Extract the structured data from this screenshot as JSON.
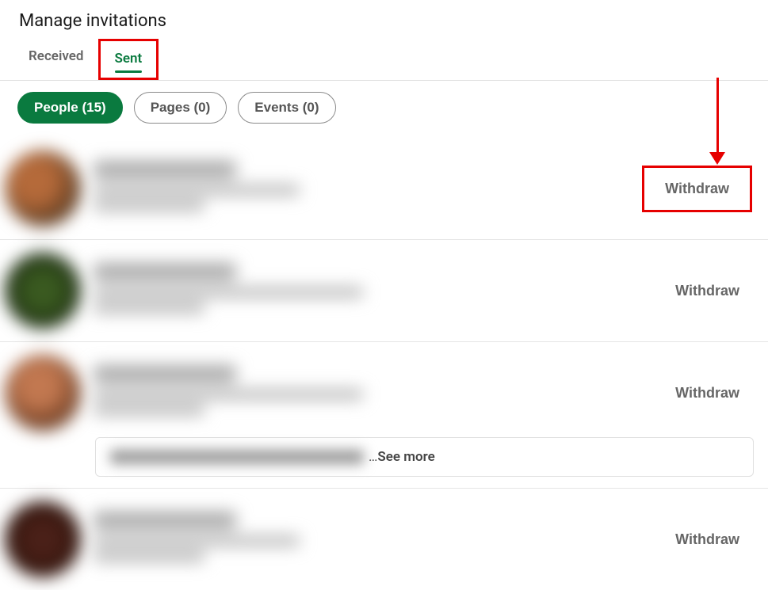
{
  "header": {
    "title": "Manage invitations"
  },
  "tabs": [
    {
      "label": "Received",
      "active": false
    },
    {
      "label": "Sent",
      "active": true
    }
  ],
  "filters": [
    {
      "label": "People (15)",
      "active": true
    },
    {
      "label": "Pages (0)",
      "active": false
    },
    {
      "label": "Events (0)",
      "active": false
    }
  ],
  "action_label": "Withdraw",
  "see_more": {
    "prefix": "… ",
    "label": "See more"
  },
  "invitations": [
    {
      "withdraw": "Withdraw"
    },
    {
      "withdraw": "Withdraw"
    },
    {
      "withdraw": "Withdraw"
    },
    {
      "withdraw": "Withdraw"
    }
  ],
  "annotations": {
    "sent_tab_highlight": {
      "color": "#e60000"
    },
    "first_withdraw_highlight": {
      "color": "#e60000"
    },
    "arrow": {
      "color": "#e60000"
    }
  }
}
